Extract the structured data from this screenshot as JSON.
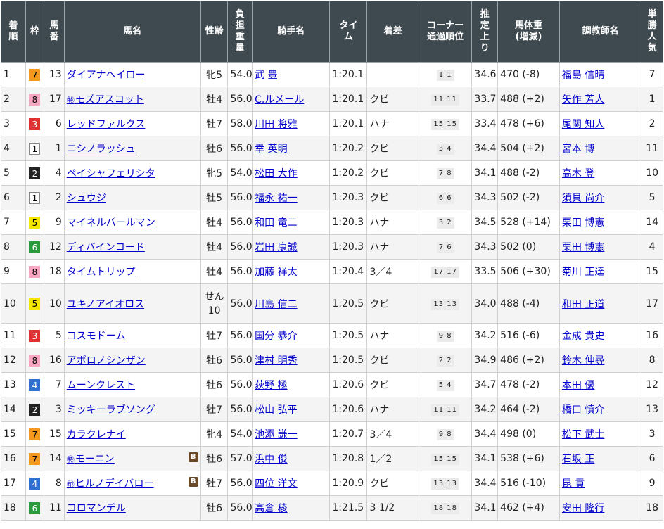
{
  "headers": {
    "rank": [
      "着",
      "順"
    ],
    "waku": [
      "枠"
    ],
    "umaban": [
      "馬",
      "番"
    ],
    "horse": [
      "馬名"
    ],
    "sexage": [
      "性齢"
    ],
    "weight": [
      "負",
      "担",
      "重",
      "量"
    ],
    "jockey": [
      "騎手名"
    ],
    "time": [
      "タイ",
      "ム"
    ],
    "margin": [
      "着差"
    ],
    "corner": [
      "コーナー",
      "通過順位"
    ],
    "last3f": [
      "推",
      "定",
      "上",
      "り"
    ],
    "bodyweight": [
      "馬体重",
      "(増減)"
    ],
    "trainer": [
      "調教師名"
    ],
    "pop": [
      "単",
      "勝",
      "人",
      "気"
    ]
  },
  "rows": [
    {
      "rank": "1",
      "waku": "7",
      "umaban": "13",
      "mark": "",
      "horse": "ダイアナヘイロー",
      "blinker": "",
      "sexage": "牝5",
      "weight": "54.0",
      "jockey": "武 豊",
      "time": "1:20.1",
      "margin": "",
      "corner": "1 1",
      "last3f": "34.6",
      "bodyweight": "470 (-8)",
      "trainer": "福島 信晴",
      "pop": "7"
    },
    {
      "rank": "2",
      "waku": "8",
      "umaban": "17",
      "mark": "㊕",
      "horse": "モズアスコット",
      "blinker": "",
      "sexage": "牡4",
      "weight": "56.0",
      "jockey": "C.ルメール",
      "time": "1:20.1",
      "margin": "クビ",
      "corner": "11 11",
      "last3f": "33.7",
      "bodyweight": "488 (+2)",
      "trainer": "矢作 芳人",
      "pop": "1"
    },
    {
      "rank": "3",
      "waku": "3",
      "umaban": "6",
      "mark": "",
      "horse": "レッドファルクス",
      "blinker": "",
      "sexage": "牡7",
      "weight": "58.0",
      "jockey": "川田 将雅",
      "time": "1:20.1",
      "margin": "ハナ",
      "corner": "15 15",
      "last3f": "33.4",
      "bodyweight": "478 (+6)",
      "trainer": "尾関 知人",
      "pop": "2"
    },
    {
      "rank": "4",
      "waku": "1",
      "umaban": "1",
      "mark": "",
      "horse": "ニシノラッシュ",
      "blinker": "",
      "sexage": "牡6",
      "weight": "56.0",
      "jockey": "幸 英明",
      "time": "1:20.2",
      "margin": "クビ",
      "corner": "3 4",
      "last3f": "34.4",
      "bodyweight": "504 (+2)",
      "trainer": "宮本 博",
      "pop": "11"
    },
    {
      "rank": "5",
      "waku": "2",
      "umaban": "4",
      "mark": "",
      "horse": "ペイシャフェリシタ",
      "blinker": "",
      "sexage": "牝5",
      "weight": "54.0",
      "jockey": "松田 大作",
      "time": "1:20.2",
      "margin": "クビ",
      "corner": "7 8",
      "last3f": "34.1",
      "bodyweight": "488 (-2)",
      "trainer": "高木 登",
      "pop": "10"
    },
    {
      "rank": "6",
      "waku": "1",
      "umaban": "2",
      "mark": "",
      "horse": "シュウジ",
      "blinker": "",
      "sexage": "牡5",
      "weight": "56.0",
      "jockey": "福永 祐一",
      "time": "1:20.3",
      "margin": "クビ",
      "corner": "6 6",
      "last3f": "34.3",
      "bodyweight": "502 (-2)",
      "trainer": "須貝 尚介",
      "pop": "5"
    },
    {
      "rank": "7",
      "waku": "5",
      "umaban": "9",
      "mark": "",
      "horse": "マイネルバールマン",
      "blinker": "",
      "sexage": "牡4",
      "weight": "56.0",
      "jockey": "和田 竜二",
      "time": "1:20.3",
      "margin": "ハナ",
      "corner": "3 2",
      "last3f": "34.5",
      "bodyweight": "528 (+14)",
      "trainer": "栗田 博憲",
      "pop": "14"
    },
    {
      "rank": "8",
      "waku": "6",
      "umaban": "12",
      "mark": "",
      "horse": "ディバインコード",
      "blinker": "",
      "sexage": "牡4",
      "weight": "56.0",
      "jockey": "岩田 康誠",
      "time": "1:20.3",
      "margin": "ハナ",
      "corner": "7 6",
      "last3f": "34.3",
      "bodyweight": "502 (0)",
      "trainer": "栗田 博憲",
      "pop": "4"
    },
    {
      "rank": "9",
      "waku": "8",
      "umaban": "18",
      "mark": "",
      "horse": "タイムトリップ",
      "blinker": "",
      "sexage": "牡4",
      "weight": "56.0",
      "jockey": "加藤 祥太",
      "time": "1:20.4",
      "margin": "3／4",
      "corner": "17 17",
      "last3f": "33.5",
      "bodyweight": "506 (+30)",
      "trainer": "菊川 正達",
      "pop": "15"
    },
    {
      "rank": "10",
      "waku": "5",
      "umaban": "10",
      "mark": "",
      "horse": "ユキノアイオロス",
      "blinker": "",
      "sexage": "せん10",
      "sexage_a": "せん",
      "sexage_b": "10",
      "weight": "56.0",
      "jockey": "川島 信二",
      "time": "1:20.5",
      "margin": "クビ",
      "corner": "13 13",
      "last3f": "34.0",
      "bodyweight": "488 (-4)",
      "trainer": "和田 正道",
      "pop": "17"
    },
    {
      "rank": "11",
      "waku": "3",
      "umaban": "5",
      "mark": "",
      "horse": "コスモドーム",
      "blinker": "",
      "sexage": "牡7",
      "weight": "56.0",
      "jockey": "国分 恭介",
      "time": "1:20.5",
      "margin": "ハナ",
      "corner": "9 8",
      "last3f": "34.2",
      "bodyweight": "516 (-6)",
      "trainer": "金成 貴史",
      "pop": "16"
    },
    {
      "rank": "12",
      "waku": "8",
      "umaban": "16",
      "mark": "",
      "horse": "アポロノシンザン",
      "blinker": "",
      "sexage": "牡6",
      "weight": "56.0",
      "jockey": "津村 明秀",
      "time": "1:20.5",
      "margin": "クビ",
      "corner": "2 2",
      "last3f": "34.9",
      "bodyweight": "486 (+2)",
      "trainer": "鈴木 伸尋",
      "pop": "8"
    },
    {
      "rank": "13",
      "waku": "4",
      "umaban": "7",
      "mark": "",
      "horse": "ムーンクレスト",
      "blinker": "",
      "sexage": "牡6",
      "weight": "56.0",
      "jockey": "荻野 極",
      "time": "1:20.6",
      "margin": "クビ",
      "corner": "5 4",
      "last3f": "34.7",
      "bodyweight": "478 (-2)",
      "trainer": "本田 優",
      "pop": "12"
    },
    {
      "rank": "14",
      "waku": "2",
      "umaban": "3",
      "mark": "",
      "horse": "ミッキーラブソング",
      "blinker": "",
      "sexage": "牡7",
      "weight": "56.0",
      "jockey": "松山 弘平",
      "time": "1:20.6",
      "margin": "ハナ",
      "corner": "11 11",
      "last3f": "34.2",
      "bodyweight": "464 (-2)",
      "trainer": "橋口 慎介",
      "pop": "13"
    },
    {
      "rank": "15",
      "waku": "7",
      "umaban": "15",
      "mark": "",
      "horse": "カラクレナイ",
      "blinker": "",
      "sexage": "牝4",
      "weight": "54.0",
      "jockey": "池添 謙一",
      "time": "1:20.7",
      "margin": "3／4",
      "corner": "9 8",
      "last3f": "34.4",
      "bodyweight": "498 (0)",
      "trainer": "松下 武士",
      "pop": "3"
    },
    {
      "rank": "16",
      "waku": "7",
      "umaban": "14",
      "mark": "㊕",
      "horse": "モーニン",
      "blinker": "B",
      "sexage": "牡6",
      "weight": "57.0",
      "jockey": "浜中 俊",
      "time": "1:20.8",
      "margin": "1／2",
      "corner": "15 15",
      "last3f": "34.1",
      "bodyweight": "538 (+6)",
      "trainer": "石坂 正",
      "pop": "6"
    },
    {
      "rank": "17",
      "waku": "4",
      "umaban": "8",
      "mark": "㊞",
      "horse": "ヒルノデイバロー",
      "blinker": "B",
      "sexage": "牡7",
      "weight": "56.0",
      "jockey": "四位 洋文",
      "time": "1:20.9",
      "margin": "クビ",
      "corner": "13 13",
      "last3f": "34.4",
      "bodyweight": "516 (-10)",
      "trainer": "昆 貢",
      "pop": "9"
    },
    {
      "rank": "18",
      "waku": "6",
      "umaban": "11",
      "mark": "",
      "horse": "コロマンデル",
      "blinker": "",
      "sexage": "牡6",
      "weight": "56.0",
      "jockey": "高倉 稜",
      "time": "1:21.5",
      "margin": "3 1/2",
      "corner": "18 18",
      "last3f": "34.1",
      "bodyweight": "462 (+4)",
      "trainer": "安田 隆行",
      "pop": "18"
    }
  ],
  "waku_colors": {
    "1": {
      "bg": "#ffffff",
      "fg": "#000000"
    },
    "2": {
      "bg": "#222222",
      "fg": "#ffffff"
    },
    "3": {
      "bg": "#e03030",
      "fg": "#ffffff"
    },
    "4": {
      "bg": "#2f6fd0",
      "fg": "#ffffff"
    },
    "5": {
      "bg": "#f5e600",
      "fg": "#000000"
    },
    "6": {
      "bg": "#2a9a3a",
      "fg": "#ffffff"
    },
    "7": {
      "bg": "#f39a1e",
      "fg": "#000000"
    },
    "8": {
      "bg": "#f6a6c0",
      "fg": "#000000"
    }
  }
}
